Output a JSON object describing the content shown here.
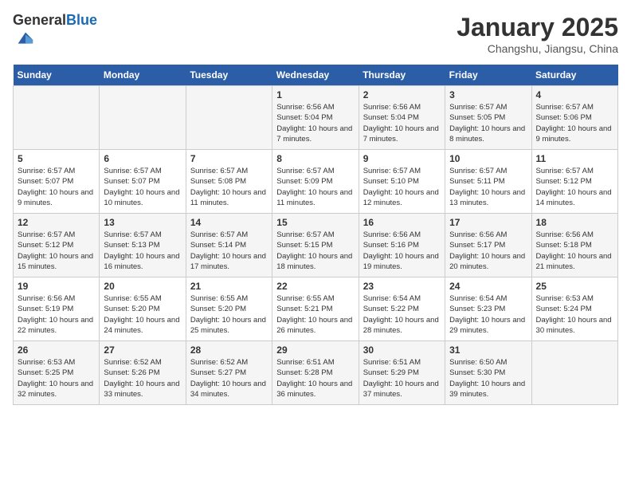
{
  "header": {
    "logo_general": "General",
    "logo_blue": "Blue",
    "month_title": "January 2025",
    "location": "Changshu, Jiangsu, China"
  },
  "days_of_week": [
    "Sunday",
    "Monday",
    "Tuesday",
    "Wednesday",
    "Thursday",
    "Friday",
    "Saturday"
  ],
  "weeks": [
    [
      {
        "day": "",
        "sunrise": "",
        "sunset": "",
        "daylight": ""
      },
      {
        "day": "",
        "sunrise": "",
        "sunset": "",
        "daylight": ""
      },
      {
        "day": "",
        "sunrise": "",
        "sunset": "",
        "daylight": ""
      },
      {
        "day": "1",
        "sunrise": "Sunrise: 6:56 AM",
        "sunset": "Sunset: 5:04 PM",
        "daylight": "Daylight: 10 hours and 7 minutes."
      },
      {
        "day": "2",
        "sunrise": "Sunrise: 6:56 AM",
        "sunset": "Sunset: 5:04 PM",
        "daylight": "Daylight: 10 hours and 7 minutes."
      },
      {
        "day": "3",
        "sunrise": "Sunrise: 6:57 AM",
        "sunset": "Sunset: 5:05 PM",
        "daylight": "Daylight: 10 hours and 8 minutes."
      },
      {
        "day": "4",
        "sunrise": "Sunrise: 6:57 AM",
        "sunset": "Sunset: 5:06 PM",
        "daylight": "Daylight: 10 hours and 9 minutes."
      }
    ],
    [
      {
        "day": "5",
        "sunrise": "Sunrise: 6:57 AM",
        "sunset": "Sunset: 5:07 PM",
        "daylight": "Daylight: 10 hours and 9 minutes."
      },
      {
        "day": "6",
        "sunrise": "Sunrise: 6:57 AM",
        "sunset": "Sunset: 5:07 PM",
        "daylight": "Daylight: 10 hours and 10 minutes."
      },
      {
        "day": "7",
        "sunrise": "Sunrise: 6:57 AM",
        "sunset": "Sunset: 5:08 PM",
        "daylight": "Daylight: 10 hours and 11 minutes."
      },
      {
        "day": "8",
        "sunrise": "Sunrise: 6:57 AM",
        "sunset": "Sunset: 5:09 PM",
        "daylight": "Daylight: 10 hours and 11 minutes."
      },
      {
        "day": "9",
        "sunrise": "Sunrise: 6:57 AM",
        "sunset": "Sunset: 5:10 PM",
        "daylight": "Daylight: 10 hours and 12 minutes."
      },
      {
        "day": "10",
        "sunrise": "Sunrise: 6:57 AM",
        "sunset": "Sunset: 5:11 PM",
        "daylight": "Daylight: 10 hours and 13 minutes."
      },
      {
        "day": "11",
        "sunrise": "Sunrise: 6:57 AM",
        "sunset": "Sunset: 5:12 PM",
        "daylight": "Daylight: 10 hours and 14 minutes."
      }
    ],
    [
      {
        "day": "12",
        "sunrise": "Sunrise: 6:57 AM",
        "sunset": "Sunset: 5:12 PM",
        "daylight": "Daylight: 10 hours and 15 minutes."
      },
      {
        "day": "13",
        "sunrise": "Sunrise: 6:57 AM",
        "sunset": "Sunset: 5:13 PM",
        "daylight": "Daylight: 10 hours and 16 minutes."
      },
      {
        "day": "14",
        "sunrise": "Sunrise: 6:57 AM",
        "sunset": "Sunset: 5:14 PM",
        "daylight": "Daylight: 10 hours and 17 minutes."
      },
      {
        "day": "15",
        "sunrise": "Sunrise: 6:57 AM",
        "sunset": "Sunset: 5:15 PM",
        "daylight": "Daylight: 10 hours and 18 minutes."
      },
      {
        "day": "16",
        "sunrise": "Sunrise: 6:56 AM",
        "sunset": "Sunset: 5:16 PM",
        "daylight": "Daylight: 10 hours and 19 minutes."
      },
      {
        "day": "17",
        "sunrise": "Sunrise: 6:56 AM",
        "sunset": "Sunset: 5:17 PM",
        "daylight": "Daylight: 10 hours and 20 minutes."
      },
      {
        "day": "18",
        "sunrise": "Sunrise: 6:56 AM",
        "sunset": "Sunset: 5:18 PM",
        "daylight": "Daylight: 10 hours and 21 minutes."
      }
    ],
    [
      {
        "day": "19",
        "sunrise": "Sunrise: 6:56 AM",
        "sunset": "Sunset: 5:19 PM",
        "daylight": "Daylight: 10 hours and 22 minutes."
      },
      {
        "day": "20",
        "sunrise": "Sunrise: 6:55 AM",
        "sunset": "Sunset: 5:20 PM",
        "daylight": "Daylight: 10 hours and 24 minutes."
      },
      {
        "day": "21",
        "sunrise": "Sunrise: 6:55 AM",
        "sunset": "Sunset: 5:20 PM",
        "daylight": "Daylight: 10 hours and 25 minutes."
      },
      {
        "day": "22",
        "sunrise": "Sunrise: 6:55 AM",
        "sunset": "Sunset: 5:21 PM",
        "daylight": "Daylight: 10 hours and 26 minutes."
      },
      {
        "day": "23",
        "sunrise": "Sunrise: 6:54 AM",
        "sunset": "Sunset: 5:22 PM",
        "daylight": "Daylight: 10 hours and 28 minutes."
      },
      {
        "day": "24",
        "sunrise": "Sunrise: 6:54 AM",
        "sunset": "Sunset: 5:23 PM",
        "daylight": "Daylight: 10 hours and 29 minutes."
      },
      {
        "day": "25",
        "sunrise": "Sunrise: 6:53 AM",
        "sunset": "Sunset: 5:24 PM",
        "daylight": "Daylight: 10 hours and 30 minutes."
      }
    ],
    [
      {
        "day": "26",
        "sunrise": "Sunrise: 6:53 AM",
        "sunset": "Sunset: 5:25 PM",
        "daylight": "Daylight: 10 hours and 32 minutes."
      },
      {
        "day": "27",
        "sunrise": "Sunrise: 6:52 AM",
        "sunset": "Sunset: 5:26 PM",
        "daylight": "Daylight: 10 hours and 33 minutes."
      },
      {
        "day": "28",
        "sunrise": "Sunrise: 6:52 AM",
        "sunset": "Sunset: 5:27 PM",
        "daylight": "Daylight: 10 hours and 34 minutes."
      },
      {
        "day": "29",
        "sunrise": "Sunrise: 6:51 AM",
        "sunset": "Sunset: 5:28 PM",
        "daylight": "Daylight: 10 hours and 36 minutes."
      },
      {
        "day": "30",
        "sunrise": "Sunrise: 6:51 AM",
        "sunset": "Sunset: 5:29 PM",
        "daylight": "Daylight: 10 hours and 37 minutes."
      },
      {
        "day": "31",
        "sunrise": "Sunrise: 6:50 AM",
        "sunset": "Sunset: 5:30 PM",
        "daylight": "Daylight: 10 hours and 39 minutes."
      },
      {
        "day": "",
        "sunrise": "",
        "sunset": "",
        "daylight": ""
      }
    ]
  ]
}
